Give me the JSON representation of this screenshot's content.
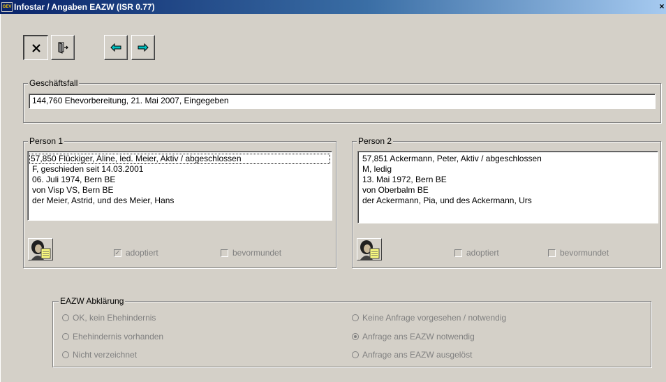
{
  "window": {
    "app_icon_text": "GEV",
    "title": "Infostar / Angaben EAZW (ISR 0.77)",
    "close_glyph": "×"
  },
  "toolbar": {
    "buttons": [
      {
        "name": "close-button",
        "icon": "x-icon"
      },
      {
        "name": "exit-door-button",
        "icon": "door-exit-icon"
      },
      {
        "name": "back-button",
        "icon": "arrow-left-icon"
      },
      {
        "name": "forward-button",
        "icon": "arrow-right-icon"
      }
    ],
    "arrow_color": "#00c0c0"
  },
  "geschaeftsfall": {
    "label": "Geschäftsfall",
    "value": "144,760  Ehevorbereitung, 21. Mai 2007, Eingegeben"
  },
  "person1": {
    "label": "Person 1",
    "lines": [
      "57,850  Flückiger, Aline, led. Meier, Aktiv / abgeschlossen",
      "F, geschieden seit 14.03.2001",
      "06. Juli 1974, Bern BE",
      "von Visp VS, Bern BE",
      "der Meier, Astrid, und des Meier, Hans"
    ],
    "adoptiert_label": "adoptiert",
    "adoptiert_checked": true,
    "bevormundet_label": "bevormundet",
    "bevormundet_checked": false
  },
  "person2": {
    "label": "Person 2",
    "lines": [
      "57,851  Ackermann, Peter, Aktiv / abgeschlossen",
      "M, ledig",
      "13. Mai 1972, Bern BE",
      "von Oberbalm BE",
      "der Ackermann, Pia, und des Ackermann, Urs"
    ],
    "adoptiert_label": "adoptiert",
    "adoptiert_checked": false,
    "bevormundet_label": "bevormundet",
    "bevormundet_checked": false
  },
  "eazw": {
    "label": "EAZW Abklärung",
    "left_options": [
      {
        "label": "OK, kein Ehehindernis",
        "selected": false
      },
      {
        "label": "Ehehindernis vorhanden",
        "selected": false
      },
      {
        "label": "Nicht verzeichnet",
        "selected": false
      }
    ],
    "right_options": [
      {
        "label": "Keine Anfrage vorgesehen / notwendig",
        "selected": false
      },
      {
        "label": "Anfrage ans EAZW notwendig",
        "selected": true
      },
      {
        "label": "Anfrage ans EAZW ausgelöst",
        "selected": false
      }
    ]
  }
}
